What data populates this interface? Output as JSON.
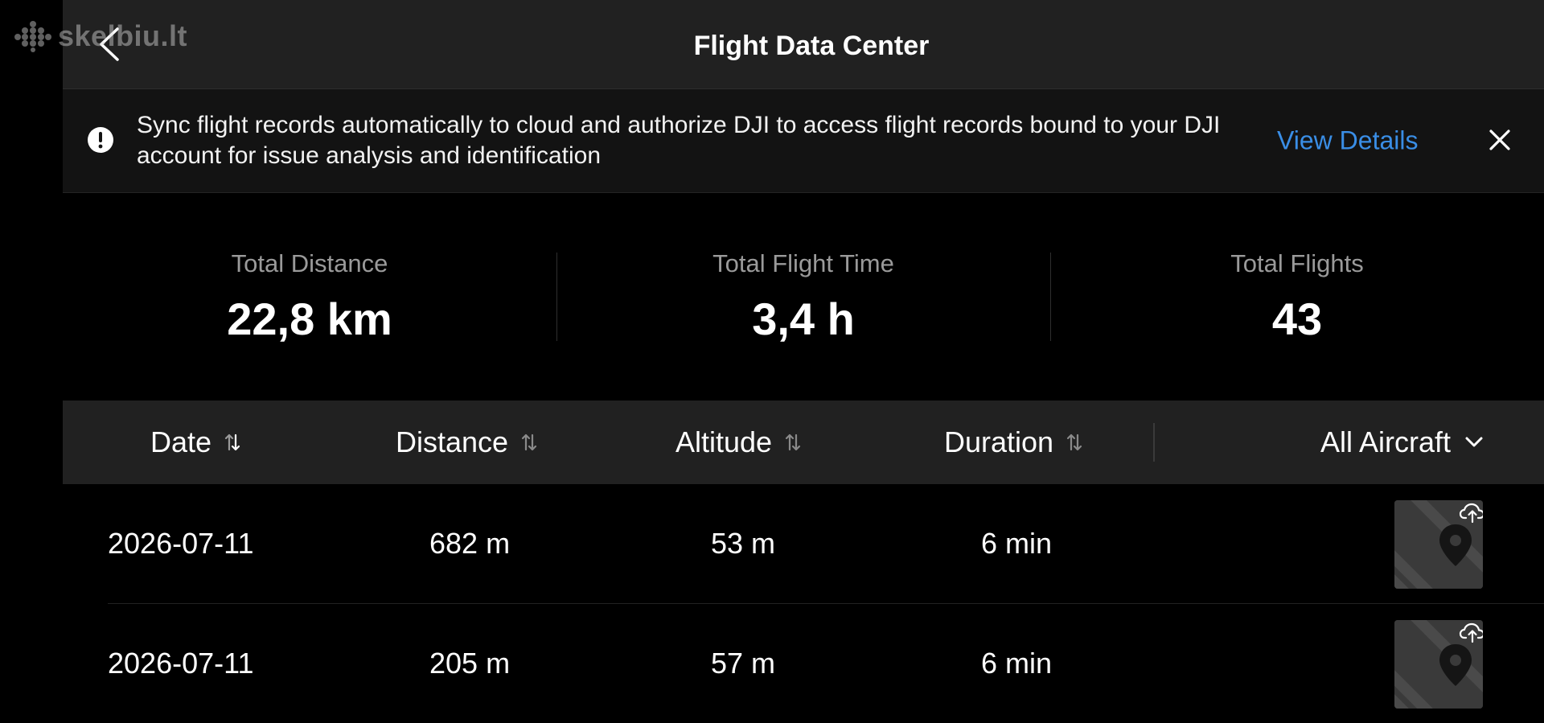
{
  "watermark": {
    "text": "skelbiu.lt",
    "icon": "dot-grid-icon"
  },
  "header": {
    "title": "Flight Data Center",
    "back_icon": "chevron-left-icon"
  },
  "banner": {
    "icon": "alert-circle-icon",
    "message": "Sync flight records automatically to cloud and authorize DJI to access flight records bound to your DJI account for issue analysis and identification",
    "link_label": "View Details",
    "link_color": "#3a8ee6",
    "close_icon": "close-icon"
  },
  "stats": [
    {
      "label": "Total Distance",
      "value": "22,8 km"
    },
    {
      "label": "Total Flight Time",
      "value": "3,4 h"
    },
    {
      "label": "Total Flights",
      "value": "43"
    }
  ],
  "table": {
    "columns": [
      {
        "label": "Date",
        "sort_icon": "sort-icon"
      },
      {
        "label": "Distance",
        "sort_icon": "sort-icon"
      },
      {
        "label": "Altitude",
        "sort_icon": "sort-icon"
      },
      {
        "label": "Duration",
        "sort_icon": "sort-icon"
      }
    ],
    "filter": {
      "label": "All Aircraft",
      "icon": "chevron-down-icon"
    },
    "rows": [
      {
        "date": "2026-07-11",
        "distance": "682 m",
        "altitude": "53 m",
        "duration": "6 min",
        "thumb_icon": "map-pin-icon",
        "status_icon": "cloud-upload-icon"
      },
      {
        "date": "2026-07-11",
        "distance": "205 m",
        "altitude": "57 m",
        "duration": "6 min",
        "thumb_icon": "map-pin-icon",
        "status_icon": "cloud-upload-icon"
      }
    ]
  }
}
